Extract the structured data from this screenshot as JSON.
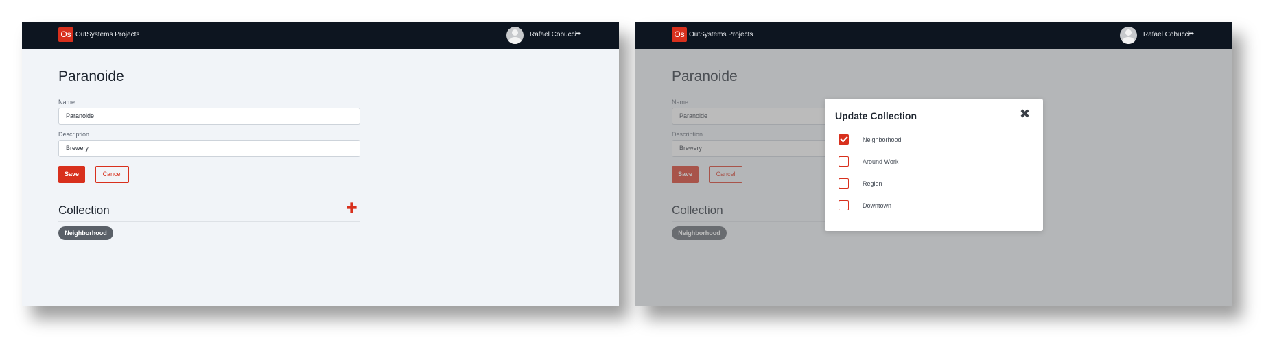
{
  "app": {
    "logo": "Os",
    "brand": "OutSystems Projects"
  },
  "user": {
    "name": "Rafael Cobucci",
    "logout_icon": "➦"
  },
  "page": {
    "title": "Paranoide"
  },
  "form": {
    "name_label": "Name",
    "name_value": "Paranoide",
    "description_label": "Description",
    "description_value": "Brewery",
    "save_label": "Save",
    "cancel_label": "Cancel"
  },
  "collection": {
    "title": "Collection",
    "add_glyph": "✚",
    "tags": [
      "Neighborhood"
    ]
  },
  "modal": {
    "title": "Update Collection",
    "close_glyph": "✖",
    "options": [
      {
        "label": "Neighborhood",
        "checked": true
      },
      {
        "label": "Around Work",
        "checked": false
      },
      {
        "label": "Region",
        "checked": false
      },
      {
        "label": "Downtown",
        "checked": false
      }
    ]
  },
  "colors": {
    "accent": "#d8301d",
    "topbar": "#0d1520",
    "tag": "#5a6068"
  }
}
